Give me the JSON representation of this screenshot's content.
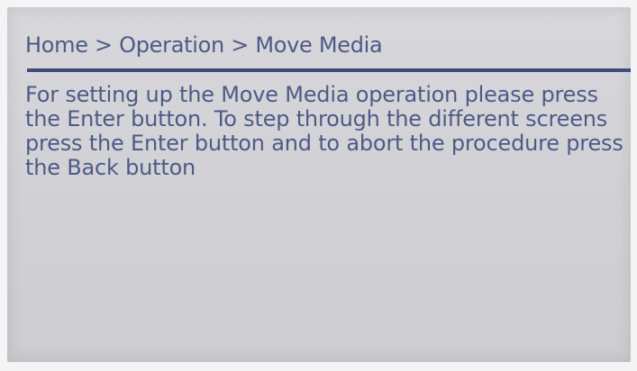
{
  "breadcrumb": {
    "text": "Home > Operation > Move Media"
  },
  "message": {
    "text": "For setting up the Move Media operation please press the Enter button. To step through the different screens press the Enter button and to abort the procedure press the Back button"
  },
  "colors": {
    "text": "#4e5a86",
    "rule": "#3d4c78",
    "screen": "#d4d4d8"
  }
}
